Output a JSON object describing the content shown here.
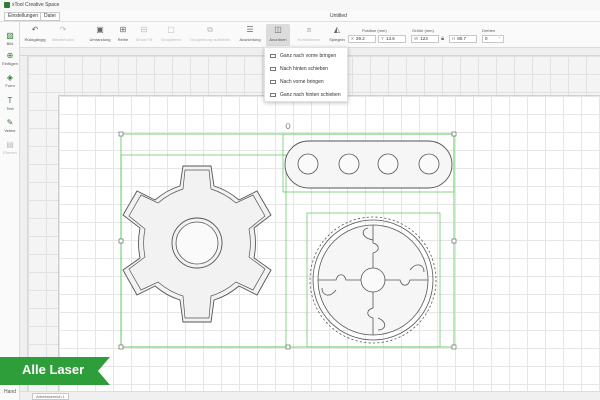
{
  "app": {
    "title": "xTool Creative Space",
    "document_title": "Untitled"
  },
  "menu": {
    "settings": "Einstellungen",
    "file": "Datei"
  },
  "toolbar": {
    "undo": "Rückgängig",
    "redo": "Wiederholen",
    "outline": "Umrandung",
    "array": "Reihe",
    "smart_fill": "Smart Fill",
    "group": "Gruppieren",
    "ungroup": "Gruppierung aufheben",
    "align": "Ausrichtung",
    "arrange": "Anordnen",
    "combine": "Kombinieren",
    "mirror": "Spiegeln"
  },
  "fields": {
    "position_label": "Position (mm)",
    "x_prefix": "X",
    "x_value": "29.2",
    "y_prefix": "Y",
    "y_value": "13.6",
    "size_label": "Größe (mm)",
    "w_prefix": "W",
    "w_value": "123",
    "h_prefix": "H",
    "h_value": "80.7",
    "rotate_label": "Drehen",
    "rotate_value": "0"
  },
  "arrange_menu": [
    "Ganz nach vorne bringen",
    "Nach hinten schieben",
    "Nach vorne bringen",
    "Ganz nach hinten schieben"
  ],
  "sidebar": [
    {
      "label": "Bild",
      "icon": "image-icon"
    },
    {
      "label": "Einfügen",
      "icon": "insert-icon"
    },
    {
      "label": "Form",
      "icon": "shape-icon"
    },
    {
      "label": "Text",
      "icon": "text-icon"
    },
    {
      "label": "Vektor",
      "icon": "pen-icon"
    },
    {
      "label": "Ebenen",
      "icon": "layers-icon"
    }
  ],
  "bottom": {
    "hand": "Hand",
    "tab": "Arbeitsbereich 1"
  },
  "promo": {
    "text": "Alle Laser"
  },
  "colors": {
    "accent": "#2e7d32",
    "selection": "#55c455",
    "outline": "#555555",
    "promo": "#2e9e3a"
  }
}
